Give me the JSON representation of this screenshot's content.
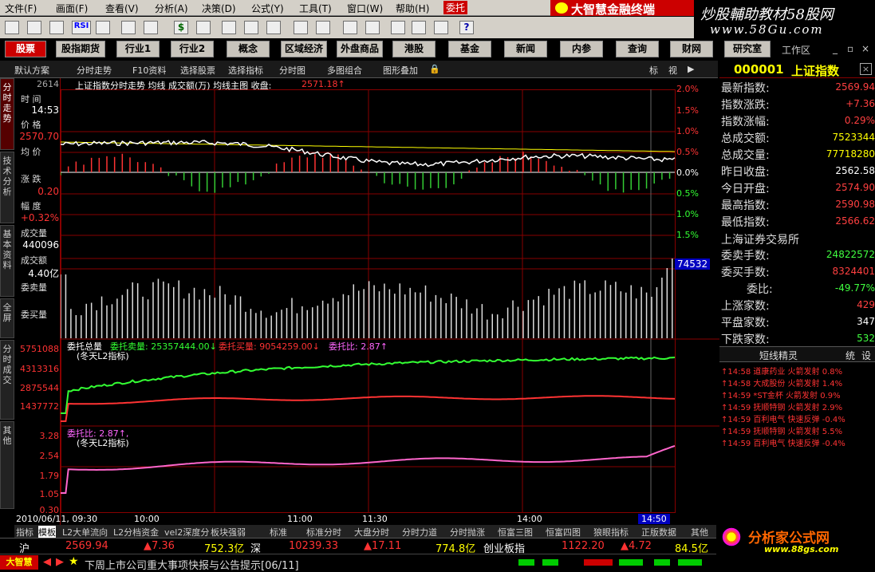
{
  "menu": [
    "文件(F)",
    "画面(F)",
    "查看(V)",
    "分析(A)",
    "决策(D)",
    "公式(Y)",
    "工具(T)",
    "窗口(W)",
    "帮助(H)",
    "委托"
  ],
  "brand": "大智慧金融终端",
  "watermark": {
    "line1": "炒股輔助教材58股网",
    "line2": "www.58Gu.com"
  },
  "nav": [
    "股票",
    "股指期货",
    "行业1",
    "行业2",
    "概念",
    "区域经济",
    "外盘商品",
    "港股",
    "基金",
    "新闻",
    "内参",
    "查询",
    "财网",
    "研究室"
  ],
  "nav_right": "工作区",
  "subbar": [
    "默认方案",
    "分时走势",
    "F10资料",
    "选择股票",
    "选择指标",
    "分时图",
    "多图组合",
    "图形叠加"
  ],
  "subbar_right": [
    "标",
    "视"
  ],
  "vtabs": [
    "分时走势",
    "技术分析",
    "基本资料",
    "全屏",
    "分时成交",
    "其他"
  ],
  "info": {
    "time_label": "时 间",
    "time": "14:53",
    "price_label": "价 格",
    "price": "2570.70",
    "avg_label": "均 价",
    "chg_label": "涨 跌",
    "chg": "0.20",
    "pct_label": "幅 度",
    "pct": "+0.32%",
    "vol_label": "成交量",
    "vol": "440096",
    "amt_label": "成交额",
    "amt": "4.40亿",
    "sell_label": "委卖量",
    "buy_label": "委买量"
  },
  "chart": {
    "title": "上证指数分时走势  均线  成交额(万)  均线主图  收盘:",
    "close": "2571.18↑",
    "left_top": "2614",
    "pct_axis": [
      "2.0%",
      "1.5%",
      "1.0%",
      "0.5%",
      "0.0%",
      "0.5%",
      "1.0%",
      "1.5%"
    ],
    "vol_badge": "74532",
    "panel2_title": "委托总量",
    "panel2_s1": "委托卖量: 25357444.00↓",
    "panel2_s2": "委托买量: 9054259.00↓",
    "panel2_s3": "委托比: 2.87↑",
    "panel2_sub": "(冬天L2指标)",
    "panel2_axis": [
      "5751088",
      "4313316",
      "2875544",
      "1437772"
    ],
    "panel3_title": "委托比: 2.87↑,",
    "panel3_sub": "(冬天L2指标)",
    "panel3_axis": [
      "3.28",
      "2.54",
      "1.79",
      "1.05",
      "0.30"
    ],
    "time_axis": [
      "2010/06/11, 09:30",
      "10:00",
      "11:00",
      "11:30",
      "14:00"
    ],
    "cursor_time": "14:50"
  },
  "right": {
    "code": "000001",
    "name": "上证指数",
    "rows": [
      {
        "label": "最新指数:",
        "value": "2569.94",
        "color": "#ff4040"
      },
      {
        "label": "指数涨跌:",
        "value": "+7.36",
        "color": "#ff4040"
      },
      {
        "label": "指数涨幅:",
        "value": "0.29%",
        "color": "#ff4040"
      },
      {
        "label": "总成交额:",
        "value": "7523344",
        "color": "#ffff00"
      },
      {
        "label": "总成交量:",
        "value": "77718280",
        "color": "#ffff00"
      },
      {
        "label": "昨日收盘:",
        "value": "2562.58",
        "color": "#ffffff"
      },
      {
        "label": "今日开盘:",
        "value": "2574.90",
        "color": "#ff4040"
      },
      {
        "label": "最高指数:",
        "value": "2590.98",
        "color": "#ff4040"
      },
      {
        "label": "最低指数:",
        "value": "2566.62",
        "color": "#ff4040"
      }
    ],
    "exchange": "上海证券交易所",
    "rows2": [
      {
        "label": "委卖手数:",
        "value": "24822572",
        "color": "#40ff40"
      },
      {
        "label": "委买手数:",
        "value": "8324401",
        "color": "#ff4040"
      },
      {
        "label": "委比:",
        "value": "-49.77%",
        "color": "#40ff40"
      },
      {
        "label": "上涨家数:",
        "value": "429",
        "color": "#ff4040"
      },
      {
        "label": "平盘家数:",
        "value": "347",
        "color": "#ffffff"
      },
      {
        "label": "下跌家数:",
        "value": "532",
        "color": "#40ff40"
      }
    ],
    "elf_title": "短线精灵",
    "elf_tabs": [
      "统",
      "设"
    ],
    "elf": [
      {
        "t": "14:58",
        "n": "道康药业",
        "a": "火箭发射",
        "v": "0.8%"
      },
      {
        "t": "14:58",
        "n": "大成股份",
        "a": "火箭发射",
        "v": "1.4%"
      },
      {
        "t": "14:59",
        "n": "*ST金杯",
        "a": "火箭发射",
        "v": "0.9%"
      },
      {
        "t": "14:59",
        "n": "抚顺特钢",
        "a": "火箭发射",
        "v": "2.9%"
      },
      {
        "t": "14:59",
        "n": "百利电气",
        "a": "快速反弹",
        "v": "-0.4%"
      },
      {
        "t": "14:59",
        "n": "抚顺特钢",
        "a": "火箭发射",
        "v": "5.5%"
      },
      {
        "t": "14:59",
        "n": "百利电气",
        "a": "快速反弹",
        "v": "-0.4%"
      }
    ]
  },
  "bottom_tabs": [
    "指标",
    "模板",
    "L2大单流向",
    "L2分档资金",
    "vel2深度分",
    "板块强弱",
    "标准",
    "标准分时",
    "大盘分时",
    "分时力道",
    "分时抛涨",
    "恒富三图",
    "恒富四图",
    "狼眼指标",
    "正版数据",
    "其他"
  ],
  "quote": {
    "sh_label": "沪",
    "sh_price": "2569.94",
    "sh_chg": "▲7.36",
    "sh_amt": "752.3亿",
    "sz_label": "深",
    "sz_price": "10239.33",
    "sz_chg": "▲17.11",
    "sz_amt": "774.8亿",
    "cy_label": "创业板指",
    "cy_price": "1122.20",
    "cy_chg": "▲4.72",
    "cy_amt": "84.5亿"
  },
  "ticker": {
    "badge": "大智慧",
    "text": "下周上市公司重大事项快报与公告提示[06/11]"
  },
  "fxj": {
    "name": "分析家公式网",
    "url": "www.88gs.com"
  }
}
